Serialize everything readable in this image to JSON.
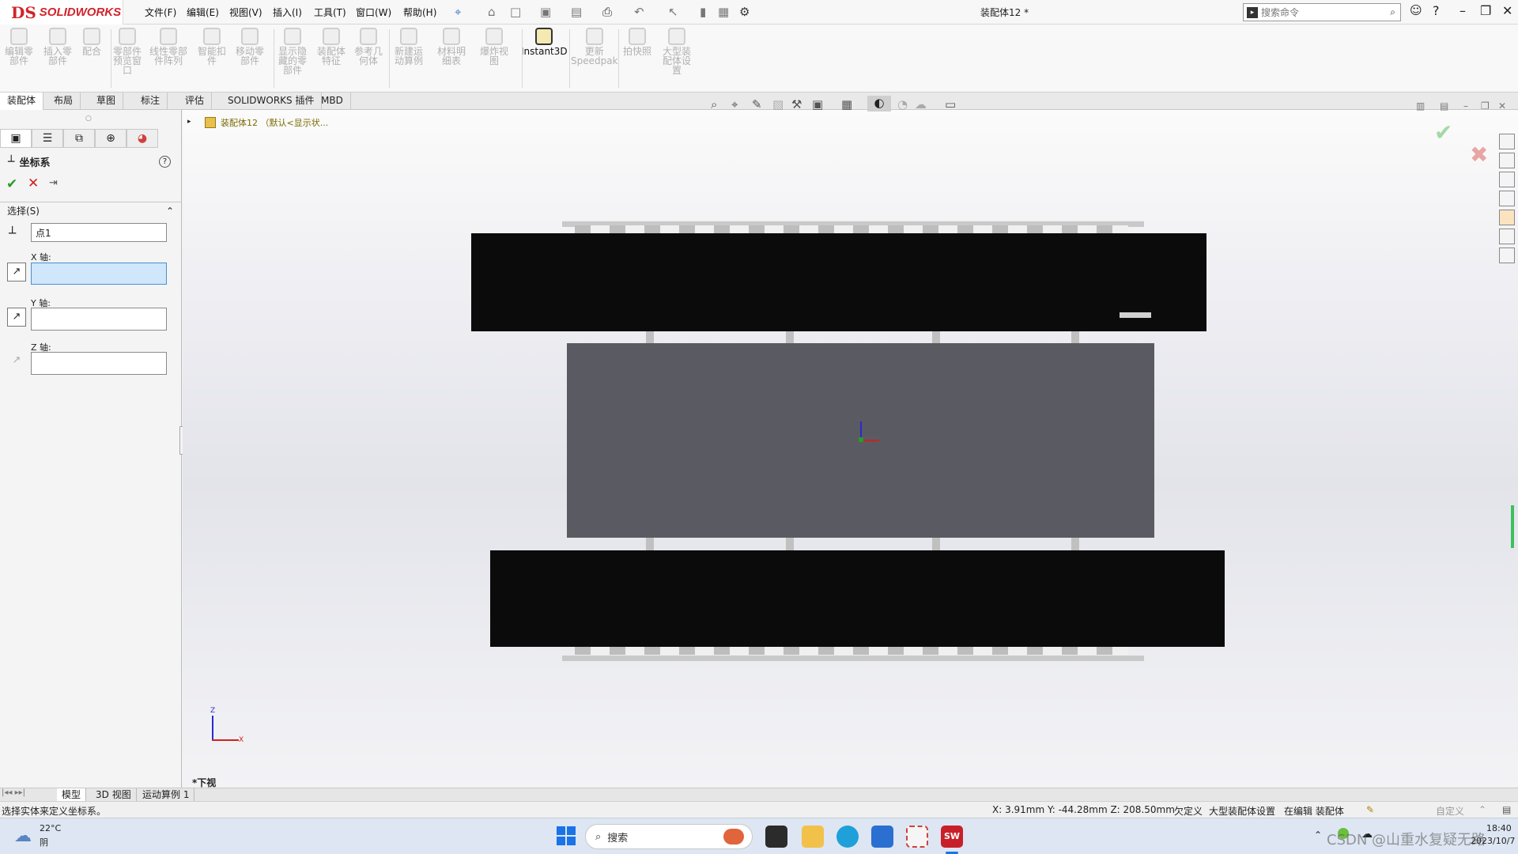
{
  "app": {
    "logo_ds": "DS",
    "logo_name": "SOLIDWORKS",
    "doc_title": "装配体12 *"
  },
  "menu": [
    "文件(F)",
    "编辑(E)",
    "视图(V)",
    "插入(I)",
    "工具(T)",
    "窗口(W)",
    "帮助(H)"
  ],
  "search": {
    "placeholder": "搜索命令"
  },
  "commands": [
    {
      "label": "编辑零\n部件"
    },
    {
      "label": "插入零\n部件"
    },
    {
      "label": "配合"
    },
    {
      "label": "零部件\n预览窗\n口"
    },
    {
      "label": "线性零部\n件阵列"
    },
    {
      "label": "智能扣\n件"
    },
    {
      "label": "移动零\n部件"
    },
    {
      "label": "显示隐\n藏的零\n部件"
    },
    {
      "label": "装配体\n特征"
    },
    {
      "label": "参考几\n何体"
    },
    {
      "label": "新建运\n动算例"
    },
    {
      "label": "材料明\n细表"
    },
    {
      "label": "爆炸视\n图"
    },
    {
      "label": "Instant3D"
    },
    {
      "label": "更新\nSpeedpak"
    },
    {
      "label": "拍快照"
    },
    {
      "label": "大型装\n配体设\n置"
    }
  ],
  "tabs": [
    "装配体",
    "布局",
    "草图",
    "标注",
    "评估",
    "SOLIDWORKS 插件",
    "MBD"
  ],
  "property_manager": {
    "title": "坐标系",
    "help": "?",
    "section_title": "选择(S)",
    "origin_value": "点1",
    "x_label": "X 轴:",
    "y_label": "Y 轴:",
    "z_label": "Z 轴:",
    "x_value": "",
    "y_value": "",
    "z_value": ""
  },
  "tree": {
    "root": "装配体12 （默认<显示状..."
  },
  "viewport": {
    "view_name": "*下视",
    "triad_x": "X",
    "triad_z": "Z"
  },
  "model_tabs": [
    "模型",
    "3D 视图",
    "运动算例 1"
  ],
  "status": {
    "message": "选择实体来定义坐标系。",
    "coords": "X: 3.91mm Y: -44.28mm Z: 208.50mm",
    "state": "欠定义",
    "large_asm": "大型装配体设置",
    "editing": "在编辑 装配体",
    "custom": "自定义"
  },
  "taskbar": {
    "temp": "22°C",
    "cond": "阴",
    "search": "搜索",
    "time": "18:40",
    "date": "2023/10/7",
    "watermark": "CSDN @山重水复疑无路"
  }
}
